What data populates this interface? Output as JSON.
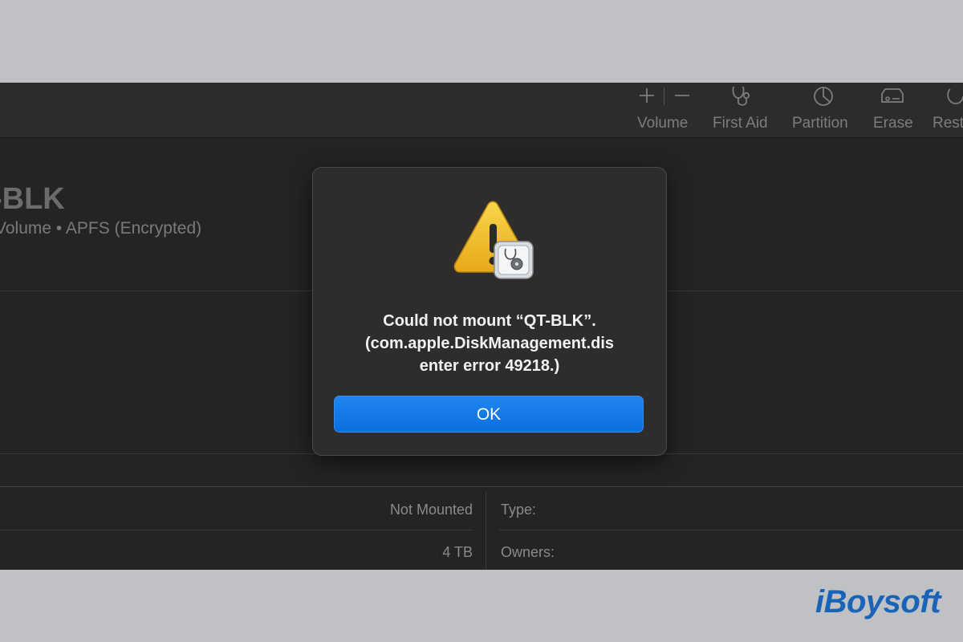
{
  "toolbar": {
    "volume_label": "Volume",
    "first_aid_label": "First Aid",
    "partition_label": "Partition",
    "erase_label": "Erase",
    "restore_label": "Rest"
  },
  "volume": {
    "name": "-BLK",
    "subtitle": "Volume • APFS (Encrypted)"
  },
  "info": {
    "mount_status": "Not Mounted",
    "capacity": "4 TB",
    "type_label": "Type:",
    "owners_label": "Owners:"
  },
  "dialog": {
    "line1": "Could not mount “QT-BLK”.",
    "line2": "(com.apple.DiskManagement.dis",
    "line3": "enter error 49218.)",
    "ok_label": "OK"
  },
  "brand": {
    "text": "iBoysoft",
    "color": "#1b63b7"
  },
  "icons": [
    "plus-icon",
    "minus-icon",
    "stethoscope-icon",
    "pie-chart-icon",
    "eraser-icon",
    "restore-icon",
    "warning-icon",
    "disk-utility-icon"
  ]
}
